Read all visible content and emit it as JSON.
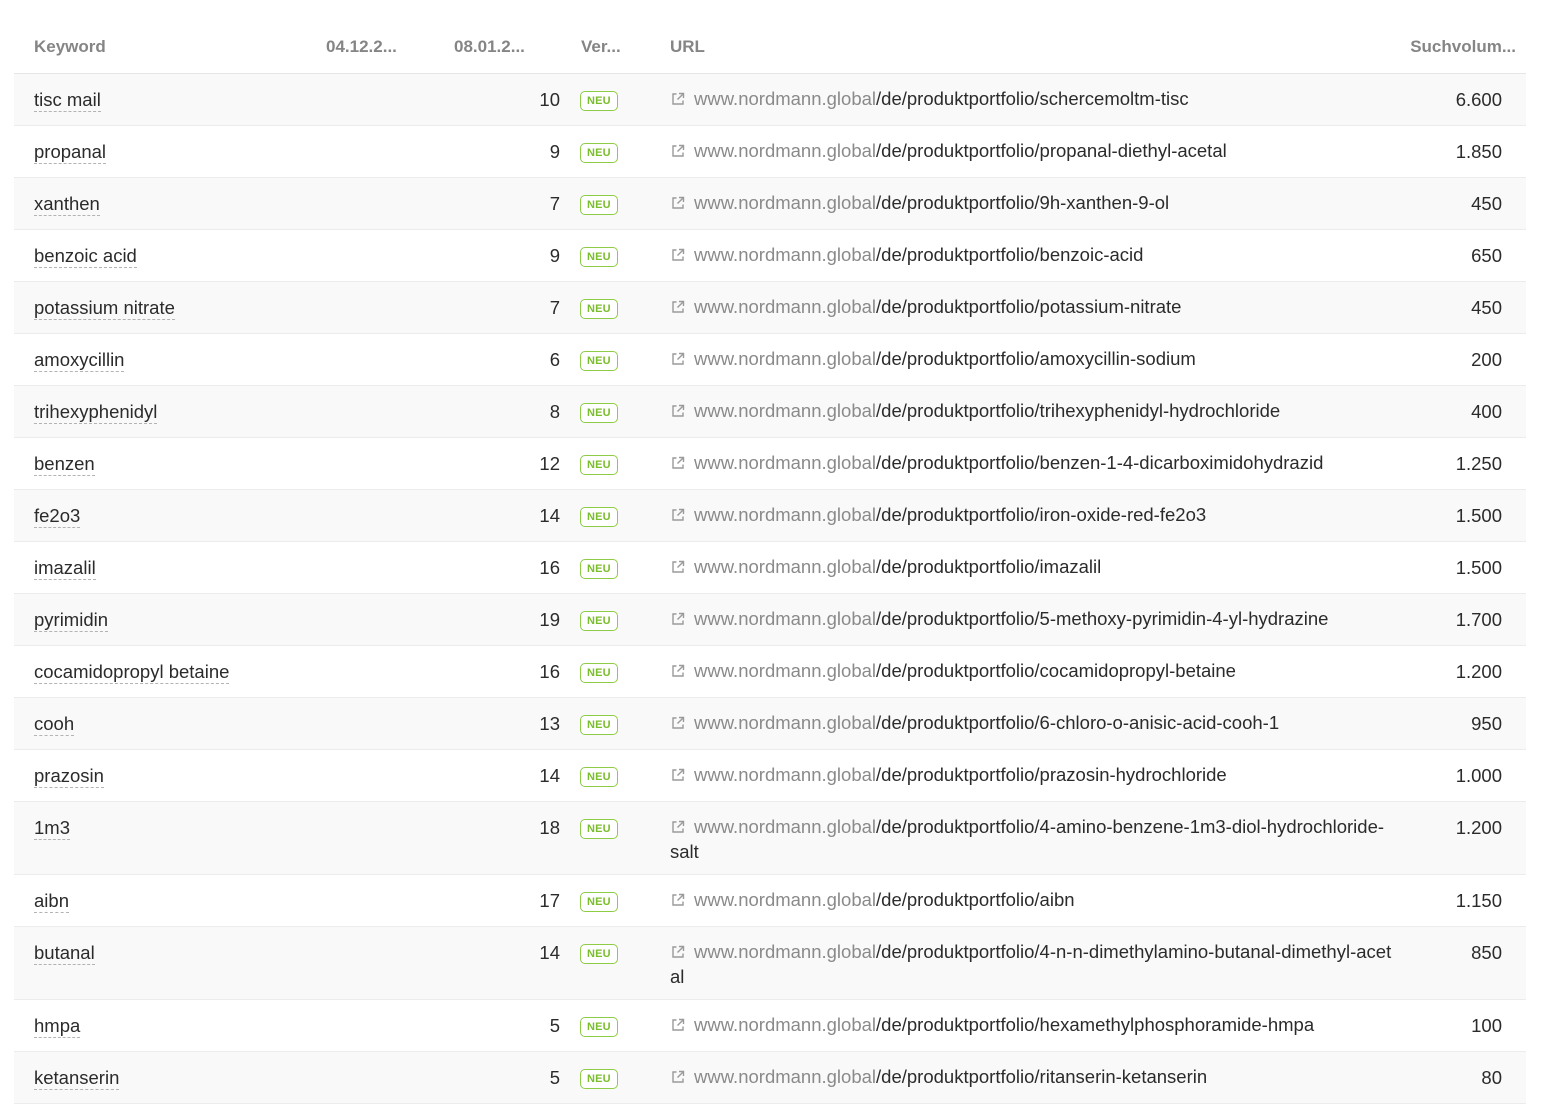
{
  "columns": {
    "keyword": "Keyword",
    "date1": "04.12.2...",
    "date2": "08.01.2...",
    "change": "Ver...",
    "url": "URL",
    "volume": "Suchvolum..."
  },
  "badge_label": "NEU",
  "colors": {
    "badge_green": "#7bbd2d",
    "host_gray": "#8a8a8a"
  },
  "icon": "external-link-icon",
  "rows": [
    {
      "keyword": "tisc mail",
      "position": "10",
      "host": "www.nordmann.global",
      "path": "/de/produktportfolio/schercemoltm-tisc",
      "volume": "6.600"
    },
    {
      "keyword": "propanal",
      "position": "9",
      "host": "www.nordmann.global",
      "path": "/de/produktportfolio/propanal-diethyl-acetal",
      "volume": "1.850"
    },
    {
      "keyword": "xanthen",
      "position": "7",
      "host": "www.nordmann.global",
      "path": "/de/produktportfolio/9h-xanthen-9-ol",
      "volume": "450"
    },
    {
      "keyword": "benzoic acid",
      "position": "9",
      "host": "www.nordmann.global",
      "path": "/de/produktportfolio/benzoic-acid",
      "volume": "650"
    },
    {
      "keyword": "potassium nitrate",
      "position": "7",
      "host": "www.nordmann.global",
      "path": "/de/produktportfolio/potassium-nitrate",
      "volume": "450"
    },
    {
      "keyword": "amoxycillin",
      "position": "6",
      "host": "www.nordmann.global",
      "path": "/de/produktportfolio/amoxycillin-sodium",
      "volume": "200"
    },
    {
      "keyword": "trihexyphenidyl",
      "position": "8",
      "host": "www.nordmann.global",
      "path": "/de/produktportfolio/trihexyphenidyl-hydrochloride",
      "volume": "400"
    },
    {
      "keyword": "benzen",
      "position": "12",
      "host": "www.nordmann.global",
      "path": "/de/produktportfolio/benzen-1-4-dicarboximidohydrazid",
      "volume": "1.250"
    },
    {
      "keyword": "fe2o3",
      "position": "14",
      "host": "www.nordmann.global",
      "path": "/de/produktportfolio/iron-oxide-red-fe2o3",
      "volume": "1.500"
    },
    {
      "keyword": "imazalil",
      "position": "16",
      "host": "www.nordmann.global",
      "path": "/de/produktportfolio/imazalil",
      "volume": "1.500"
    },
    {
      "keyword": "pyrimidin",
      "position": "19",
      "host": "www.nordmann.global",
      "path": "/de/produktportfolio/5-methoxy-pyrimidin-4-yl-hydrazine",
      "volume": "1.700"
    },
    {
      "keyword": "cocamidopropyl betaine",
      "position": "16",
      "host": "www.nordmann.global",
      "path": "/de/produktportfolio/cocamidopropyl-betaine",
      "volume": "1.200"
    },
    {
      "keyword": "cooh",
      "position": "13",
      "host": "www.nordmann.global",
      "path": "/de/produktportfolio/6-chloro-o-anisic-acid-cooh-1",
      "volume": "950"
    },
    {
      "keyword": "prazosin",
      "position": "14",
      "host": "www.nordmann.global",
      "path": "/de/produktportfolio/prazosin-hydrochloride",
      "volume": "1.000"
    },
    {
      "keyword": "1m3",
      "position": "18",
      "host": "www.nordmann.global",
      "path": "/de/produktportfolio/4-amino-benzene-1m3-diol-hydrochloride-salt",
      "volume": "1.200"
    },
    {
      "keyword": "aibn",
      "position": "17",
      "host": "www.nordmann.global",
      "path": "/de/produktportfolio/aibn",
      "volume": "1.150"
    },
    {
      "keyword": "butanal",
      "position": "14",
      "host": "www.nordmann.global",
      "path": "/de/produktportfolio/4-n-n-dimethylamino-butanal-dimethyl-acetal",
      "volume": "850"
    },
    {
      "keyword": "hmpa",
      "position": "5",
      "host": "www.nordmann.global",
      "path": "/de/produktportfolio/hexamethylphosphoramide-hmpa",
      "volume": "100"
    },
    {
      "keyword": "ketanserin",
      "position": "5",
      "host": "www.nordmann.global",
      "path": "/de/produktportfolio/ritanserin-ketanserin",
      "volume": "80"
    }
  ]
}
